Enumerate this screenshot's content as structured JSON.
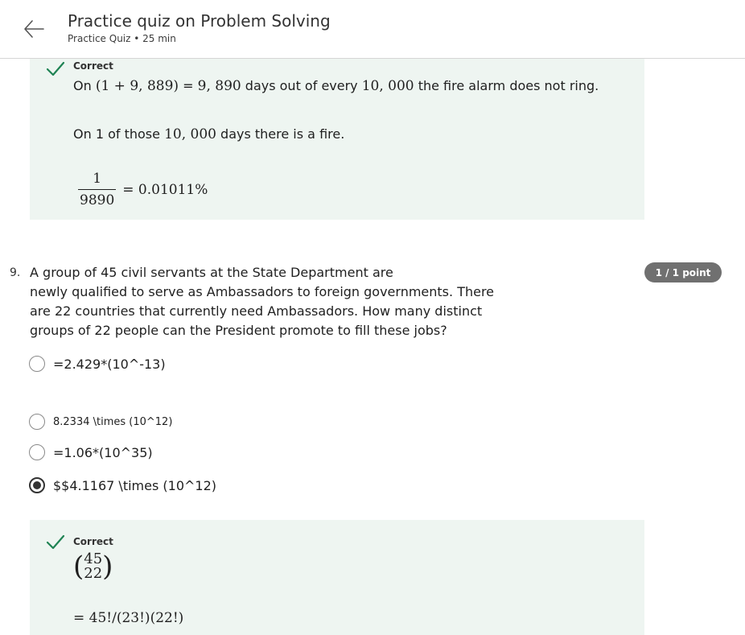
{
  "header": {
    "title": "Practice quiz on Problem Solving",
    "subtitle": "Practice Quiz • 25 min",
    "back_icon": "arrow-left-icon"
  },
  "feedback_prev": {
    "status": "Correct",
    "line1_pre": "On ",
    "line1_math1": "(1 + 9, 889)",
    "line1_mid": " = ",
    "line1_math2": "9, 890",
    "line1_post1": " days out of every ",
    "line1_math3": "10, 000",
    "line1_post2": " the fire alarm does not ring.",
    "line2_pre": "On 1 of those ",
    "line2_math": "10, 000",
    "line2_post": " days there is a fire.",
    "frac_num": "1",
    "frac_den": "9890",
    "frac_result": "= 0.01011%"
  },
  "question": {
    "number": "9.",
    "text_line1": "A group of 45 civil servants at the State Department are",
    "text_rest": "newly qualified to serve as Ambassadors to foreign governments. There are 22 countries that currently need Ambassadors. How many distinct groups of 22 people can the President promote to fill these jobs?",
    "points": "1 / 1 point",
    "options": [
      {
        "label": "=2.429*(10^-13)",
        "selected": false
      },
      {
        "label": "8.2334 \\times (10^12)",
        "selected": false
      },
      {
        "label": "=1.06*(10^35)",
        "selected": false
      },
      {
        "label": "$$4.1167 \\times (10^12)",
        "selected": true
      }
    ]
  },
  "feedback_q9": {
    "status": "Correct",
    "binom_top": "45",
    "binom_bottom": "22",
    "equation": "= 45!/(23!)(22!)"
  },
  "colors": {
    "feedback_bg": "#eef5f1",
    "check_green": "#1f8354",
    "badge_bg": "#707070"
  }
}
